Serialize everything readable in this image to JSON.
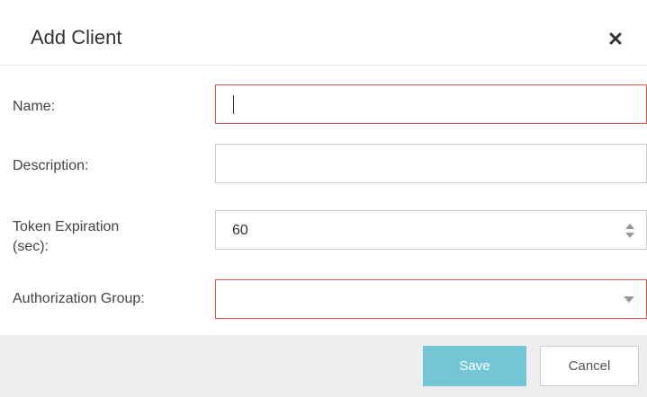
{
  "dialog": {
    "title": "Add Client",
    "close_icon": "close-icon"
  },
  "form": {
    "name": {
      "label": "Name:",
      "value": "",
      "state": "error"
    },
    "description": {
      "label": "Description:",
      "value": ""
    },
    "token_expiration": {
      "label_line1": "Token Expiration",
      "label_line2": "(sec):",
      "value": "60"
    },
    "authorization_group": {
      "label": "Authorization Group:",
      "value": "",
      "state": "error"
    }
  },
  "footer": {
    "save_label": "Save",
    "cancel_label": "Cancel"
  },
  "colors": {
    "error_border": "#d9584a",
    "primary_button": "#73c6d6",
    "footer_background": "#eeeeee"
  },
  "icons": [
    "close-icon",
    "spinner-up-icon",
    "spinner-down-icon",
    "chevron-down-icon"
  ]
}
